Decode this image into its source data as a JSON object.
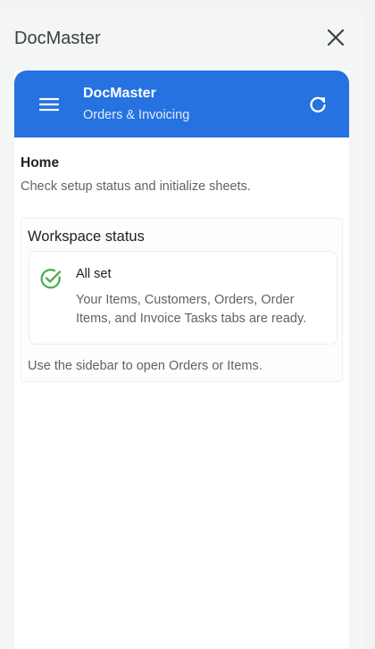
{
  "panel": {
    "title": "DocMaster",
    "close_icon": "close-icon"
  },
  "appbar": {
    "menu_icon": "hamburger-menu-icon",
    "title": "DocMaster",
    "subtitle": "Orders & Invoicing",
    "refresh_icon": "refresh-icon",
    "color": "#2572e0"
  },
  "home": {
    "heading": "Home",
    "description": "Check setup status and initialize sheets."
  },
  "workspace_status": {
    "title": "Workspace status",
    "item": {
      "icon": "check-circle-icon",
      "icon_color": "#4caf50",
      "title": "All set",
      "description": "Your Items, Customers, Orders, Order Items, and Invoice Tasks tabs are ready."
    },
    "footer": "Use the sidebar to open Orders or Items."
  }
}
